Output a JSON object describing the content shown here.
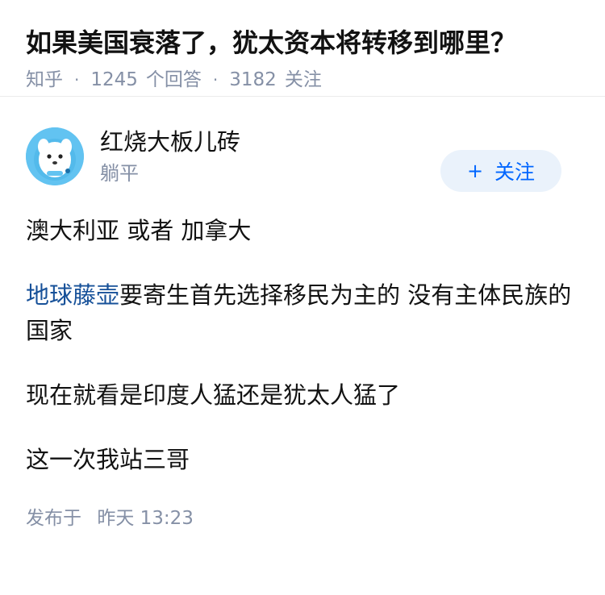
{
  "question": {
    "title": "如果美国衰落了，犹太资本将转移到哪里？",
    "source": "知乎",
    "answers_count": "1245",
    "answers_label": "个回答",
    "followers_count": "3182",
    "followers_label": "关注"
  },
  "answer": {
    "author": {
      "name": "红烧大板儿砖",
      "bio": "躺平",
      "avatar_icon": "cartoon-mascot-avatar"
    },
    "follow_button": {
      "icon": "+",
      "label": "关注"
    },
    "paragraphs": {
      "p1": "澳大利亚 或者 加拿大",
      "p2_link": "地球藤壶",
      "p2_rest": "要寄生首先选择移民为主的 没有主体民族的国家",
      "p3": "现在就看是印度人猛还是犹太人猛了",
      "p4": "这一次我站三哥"
    },
    "publish": {
      "label": "发布于",
      "day": "昨天",
      "time": "13:23"
    }
  },
  "colors": {
    "link": "#175199",
    "meta_gray": "#8590a6",
    "follow_bg": "#eaf2fb",
    "follow_text": "#0066ff",
    "avatar_bg": "#62c3f1"
  }
}
